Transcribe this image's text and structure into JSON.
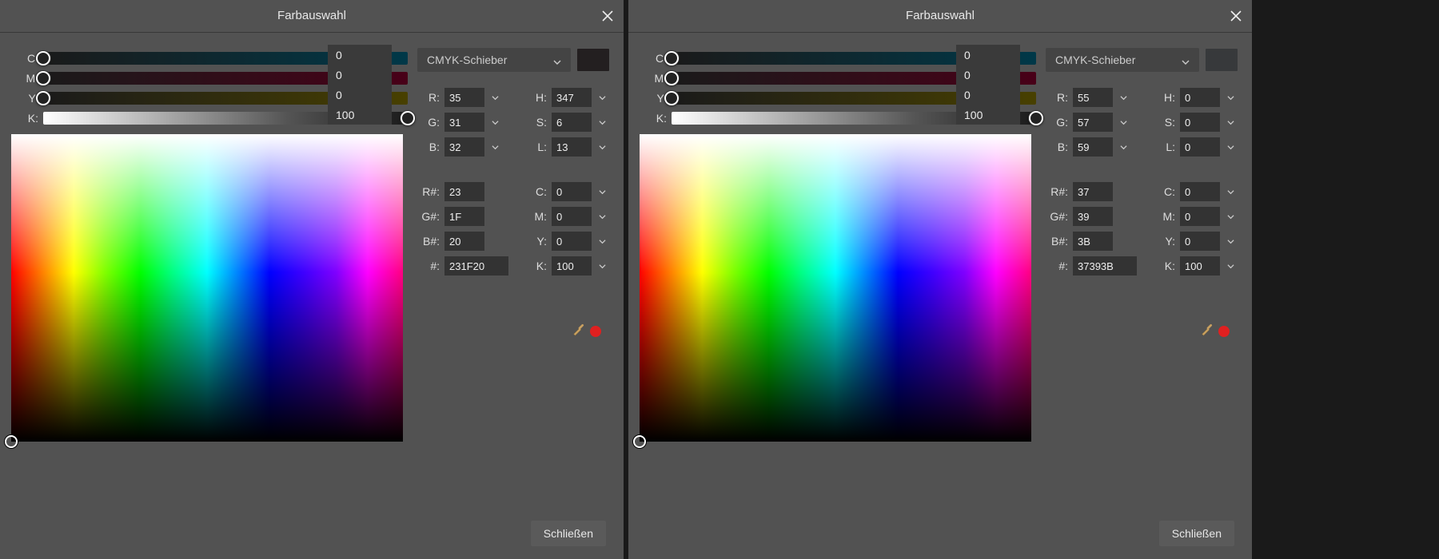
{
  "panels": [
    {
      "title": "Farbauswahl",
      "mode_label": "CMYK-Schieber",
      "close_label": "Schließen",
      "preview_color": "#231f20",
      "sliders": {
        "C": {
          "value": "0",
          "thumb_pct": 0
        },
        "M": {
          "value": "0",
          "thumb_pct": 0
        },
        "Y": {
          "value": "0",
          "thumb_pct": 0
        },
        "K": {
          "value": "100",
          "thumb_pct": 100
        }
      },
      "rgb_group": {
        "R": "35",
        "G": "31",
        "B": "32"
      },
      "hsl_group": {
        "H": "347",
        "S": "6",
        "L": "13"
      },
      "hex_group": {
        "Rh": "23",
        "Gh": "1F",
        "Bh": "20",
        "hex": "231F20"
      },
      "cmyk_group": {
        "C": "0",
        "M": "0",
        "Y": "0",
        "K": "100"
      },
      "field_marker": {
        "x_pct": 0,
        "y_pct": 100
      }
    },
    {
      "title": "Farbauswahl",
      "mode_label": "CMYK-Schieber",
      "close_label": "Schließen",
      "preview_color": "#37393b",
      "sliders": {
        "C": {
          "value": "0",
          "thumb_pct": 0
        },
        "M": {
          "value": "0",
          "thumb_pct": 0
        },
        "Y": {
          "value": "0",
          "thumb_pct": 0
        },
        "K": {
          "value": "100",
          "thumb_pct": 100
        }
      },
      "rgb_group": {
        "R": "55",
        "G": "57",
        "B": "59"
      },
      "hsl_group": {
        "H": "0",
        "S": "0",
        "L": "0"
      },
      "hex_group": {
        "Rh": "37",
        "Gh": "39",
        "Bh": "3B",
        "hex": "37393B"
      },
      "cmyk_group": {
        "C": "0",
        "M": "0",
        "Y": "0",
        "K": "100"
      },
      "field_marker": {
        "x_pct": 0,
        "y_pct": 100
      }
    }
  ],
  "labels": {
    "C": "C:",
    "M": "M:",
    "Y": "Y:",
    "K": "K:",
    "R": "R:",
    "G": "G:",
    "B": "B:",
    "H": "H:",
    "S": "S:",
    "L": "L:",
    "Rh": "R#:",
    "Gh": "G#:",
    "Bh": "B#:",
    "hex": "#:"
  }
}
